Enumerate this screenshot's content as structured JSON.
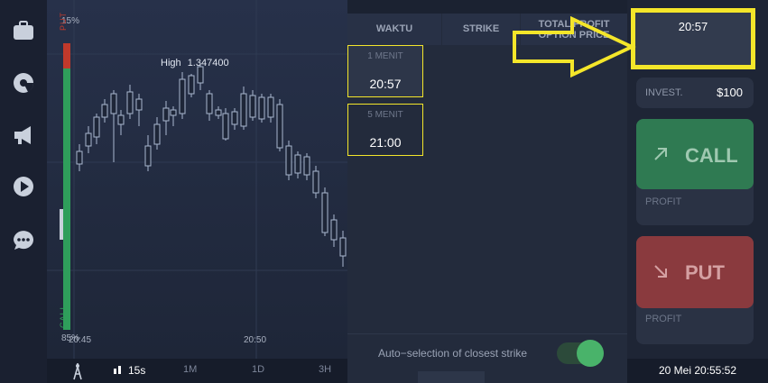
{
  "chart": {
    "pct_top": "15%",
    "pct_bottom": "85%",
    "gauge_put": "PUT",
    "gauge_call": "CALL",
    "high_label": "High",
    "high_value": "1.347400",
    "time_left": "20:45",
    "time_mid": "20:50"
  },
  "toolbar": {
    "interval": "15s",
    "t1": "1M",
    "t2": "1D",
    "t3": "3H"
  },
  "strike_table": {
    "col_waktu": "WAKTU",
    "col_strike": "STRIKE",
    "col_total_profit": "TOTAL PROFIT",
    "col_option_price": "OPTION PRICE",
    "expirations": [
      {
        "label": "1 MENIT",
        "time": "20:57"
      },
      {
        "label": "5 MENIT",
        "time": "21:00"
      }
    ],
    "auto_selection_label": "Auto−selection of closest strike",
    "auto_selection_on": true
  },
  "trade_panel": {
    "expiry_time": "20:57",
    "invest_label": "INVEST.",
    "invest_value": "$100",
    "call_label": "CALL",
    "put_label": "PUT",
    "profit_label": "PROFIT",
    "clock": "20 Mei 20:55:52"
  },
  "colors": {
    "call": "#2f9e5b",
    "put": "#c0392b",
    "highlight": "#f4e62a",
    "toggle": "#49b36a"
  },
  "icons": [
    "briefcase-icon",
    "pie-chart-icon",
    "megaphone-icon",
    "play-icon",
    "chat-icon",
    "tools-icon",
    "candle-icon"
  ]
}
